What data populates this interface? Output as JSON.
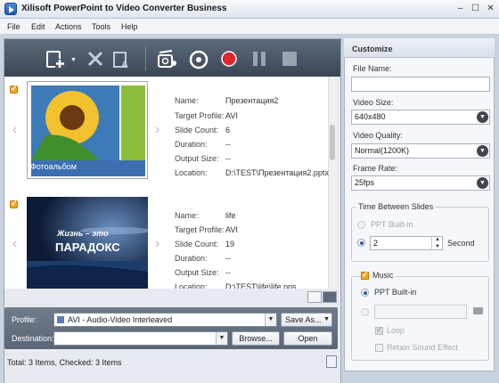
{
  "window": {
    "title": "Xilisoft PowerPoint to Video Converter Business"
  },
  "menu": [
    "File",
    "Edit",
    "Actions",
    "Tools",
    "Help"
  ],
  "items": [
    {
      "thumb_caption": "Фотоальбом",
      "name_label": "Name:",
      "name": "Презентация2",
      "profile_label": "Target Profile:",
      "profile": "AVI",
      "slides_label": "Slide Count:",
      "slides": "6",
      "duration_label": "Duration:",
      "duration": "--",
      "output_label": "Output Size:",
      "output": "--",
      "location_label": "Location:",
      "location": "D:\\TEST\\Презентация2.pptx"
    },
    {
      "thumb_line1": "Жизнь – это",
      "thumb_line2": "ПАРАДОКС",
      "name_label": "Name:",
      "name": "life",
      "profile_label": "Target Profile:",
      "profile": "AVI",
      "slides_label": "Slide Count:",
      "slides": "19",
      "duration_label": "Duration:",
      "duration": "--",
      "output_label": "Output Size:",
      "output": "--",
      "location_label": "Location:",
      "location": "D:\\TEST\\life\\life.pps"
    }
  ],
  "bottom": {
    "profile_label": "Profile:",
    "profile_value": "AVI - Audio-Video Interleaved",
    "save_as": "Save As...",
    "destination_label": "Destination:",
    "destination_value": "",
    "browse": "Browse...",
    "open": "Open"
  },
  "status": "Total: 3 Items, Checked: 3 Items",
  "customize": {
    "title": "Customize",
    "file_name_label": "File Name:",
    "file_name_value": "",
    "video_size_label": "Video Size:",
    "video_size_value": "640x480",
    "video_quality_label": "Video Quality:",
    "video_quality_value": "Normal(1200K)",
    "frame_rate_label": "Frame Rate:",
    "frame_rate_value": "25fps",
    "tbs_label": "Time Between Slides",
    "ppt_builtin": "PPT Built-in",
    "seconds_value": "2",
    "second_label": "Second",
    "music_label": "Music",
    "music_ppt_builtin": "PPT Built-in",
    "music_file_value": "",
    "loop_label": "Loop",
    "retain_label": "Retain Sound Effect"
  },
  "colors": {
    "accent": "#f5a623",
    "toolbar": "#4a5666",
    "record": "#e0262b"
  }
}
